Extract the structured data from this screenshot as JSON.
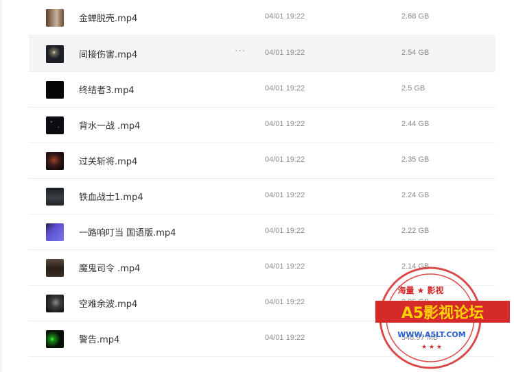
{
  "files": [
    {
      "name": "金蝉脱壳.mp4",
      "date": "04/01 19:22",
      "size": "2.68 GB",
      "thumb": "#8a6a50"
    },
    {
      "name": "间接伤害.mp4",
      "date": "04/01 19:22",
      "size": "2.54 GB",
      "thumb": "#1c1f26",
      "more": "···"
    },
    {
      "name": "终结者3.mp4",
      "date": "04/01 19:22",
      "size": "2.5 GB",
      "thumb": "#050505"
    },
    {
      "name": "背水一战 .mp4",
      "date": "04/01 19:22",
      "size": "2.44 GB",
      "thumb": "#0b0d12"
    },
    {
      "name": "过关斩将.mp4",
      "date": "04/01 19:22",
      "size": "2.35 GB",
      "thumb": "#3a1a1a"
    },
    {
      "name": "铁血战士1.mp4",
      "date": "04/01 19:22",
      "size": "2.24 GB",
      "thumb": "#262b2e"
    },
    {
      "name": "一路响叮当 国语版.mp4",
      "date": "04/01 19:22",
      "size": "2.22 GB",
      "thumb": "#5b4fd0"
    },
    {
      "name": "魔鬼司令 .mp4",
      "date": "04/01 19:22",
      "size": "2.14 GB",
      "thumb": "#3a2a22"
    },
    {
      "name": "空难余波.mp4",
      "date": "04/01 19:22",
      "size": "2.05 GB",
      "thumb": "#2e2e2e"
    },
    {
      "name": "警告.mp4",
      "date": "04/01 19:22",
      "size": "548.97 MB",
      "thumb": "#061006"
    }
  ],
  "watermark": {
    "top_text": "海量 ★ 影视",
    "main_text": "A5影视论坛",
    "url_text": "WWW.A5LT.COM",
    "color": "#d42a2a",
    "banner_text_color": "#ffd200"
  }
}
